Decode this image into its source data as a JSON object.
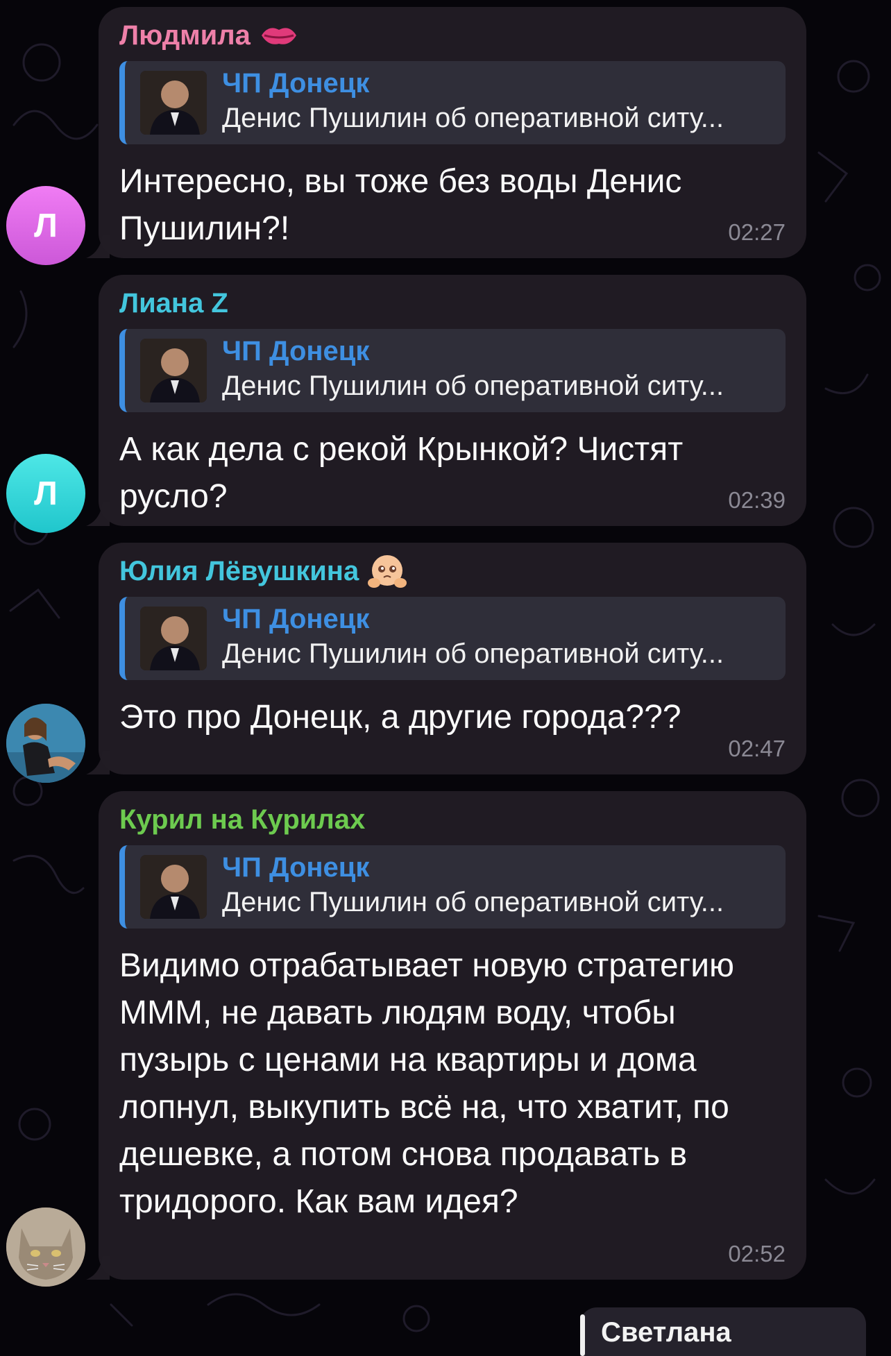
{
  "messages": [
    {
      "sender": "Людмила",
      "sender_color": "#ee80a9",
      "sender_emoji": "lips-icon",
      "avatar_letter": "Л",
      "reply": {
        "title": "ЧП Донецк",
        "text": "Денис Пушилин об оперативной ситу..."
      },
      "text": "Интересно, вы тоже без воды Денис Пушилин?!",
      "time": "02:27"
    },
    {
      "sender": "Лиана Z",
      "sender_color": "#43c6dd",
      "avatar_letter": "Л",
      "reply": {
        "title": "ЧП Донецк",
        "text": "Денис Пушилин об оперативной ситу..."
      },
      "text": "А как дела с рекой Крынкой? Чистят русло?",
      "time": "02:39"
    },
    {
      "sender": "Юлия Лёвушкина",
      "sender_color": "#43c6dd",
      "sender_emoji": "pleading-face-icon",
      "reply": {
        "title": "ЧП Донецк",
        "text": "Денис Пушилин об оперативной ситу..."
      },
      "text": "Это про Донецк, а другие города???",
      "time": "02:47"
    },
    {
      "sender": "Курил на Курилах",
      "sender_color": "#6dcb4f",
      "reply": {
        "title": "ЧП Донецк",
        "text": "Денис Пушилин об оперативной ситу..."
      },
      "text": "Видимо отрабатывает новую стратегию МММ, не давать людям воду, чтобы пузырь с ценами на квартиры и дома лопнул, выкупить всё на, что хватит, по дешевке, а потом снова продавать в тридорого. Как вам идея?",
      "time": "02:52"
    }
  ],
  "next_message": {
    "sender": "Светлана"
  }
}
